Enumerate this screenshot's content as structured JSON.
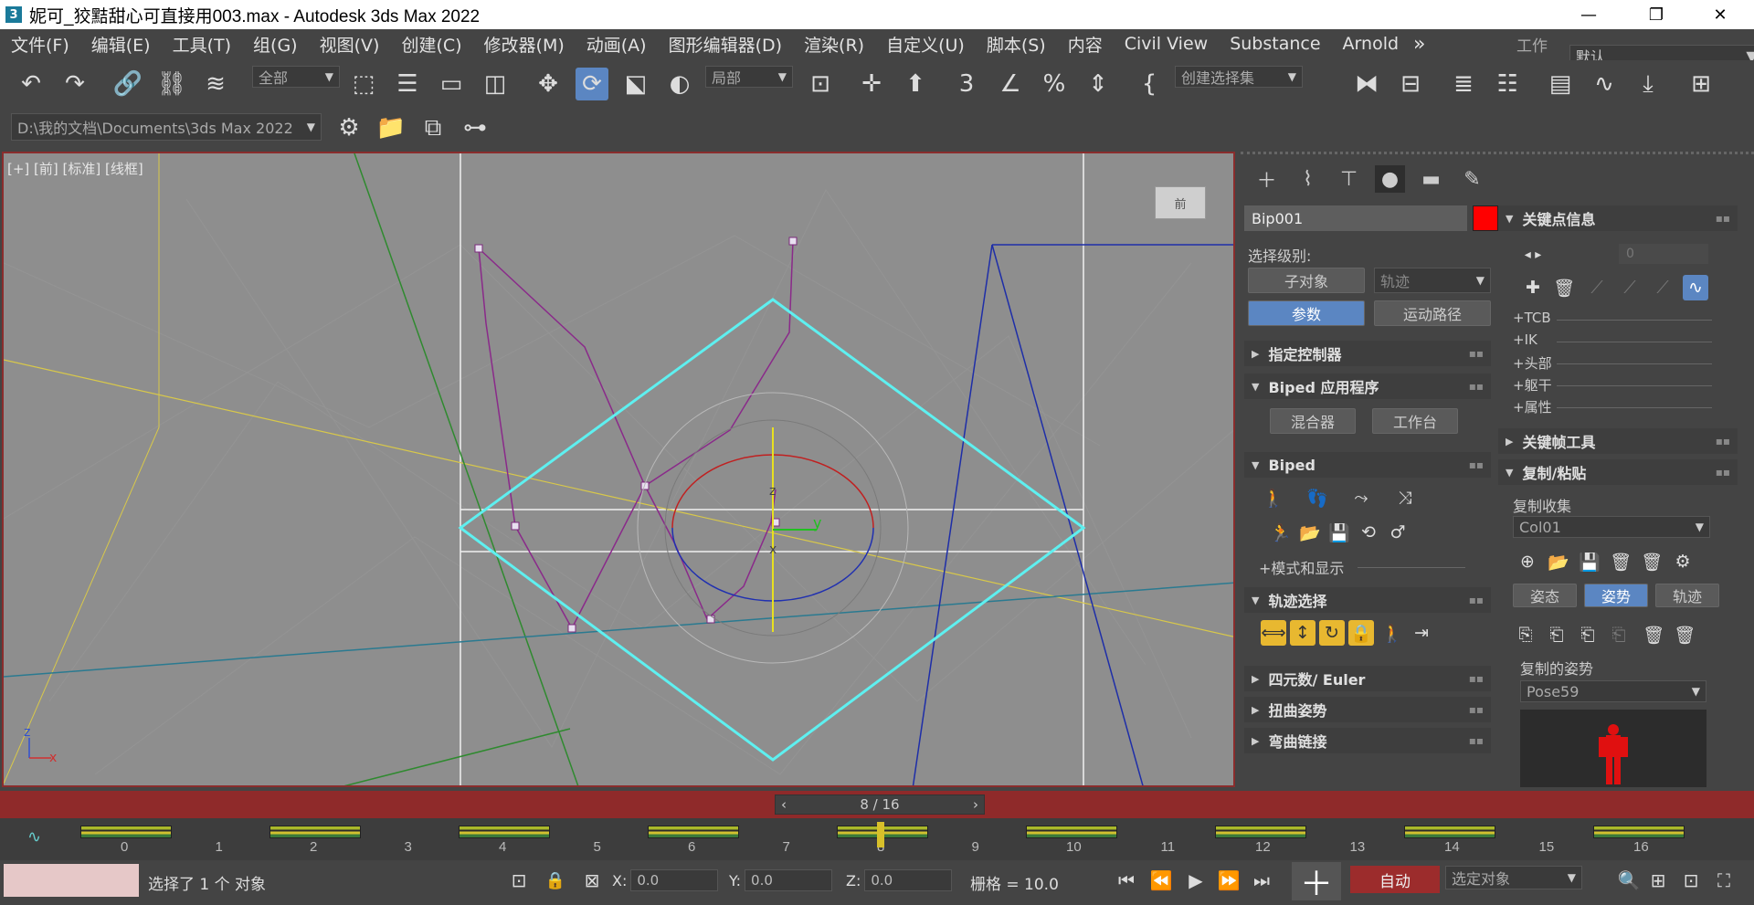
{
  "window": {
    "title": "妮可_狡黠甜心可直接用003.max - Autodesk 3ds Max 2022",
    "app_icon": "3",
    "minimize": "—",
    "restore": "❐",
    "close": "✕"
  },
  "menu": {
    "items": [
      "文件(F)",
      "编辑(E)",
      "工具(T)",
      "组(G)",
      "视图(V)",
      "创建(C)",
      "修改器(M)",
      "动画(A)",
      "图形编辑器(D)",
      "渲染(R)",
      "自定义(U)",
      "脚本(S)",
      "内容",
      "Civil View",
      "Substance",
      "Arnold"
    ],
    "more": "»",
    "workspace_label": "工作区:",
    "workspace_value": "默认"
  },
  "toolbar": {
    "filter_dropdown": "全部",
    "coord_dropdown": "局部",
    "selection_set_dropdown": "创建选择集",
    "path_dropdown": "D:\\我的文档\\Documents\\3ds Max 2022"
  },
  "viewport": {
    "label": "[+] [前] [标准] [线框]",
    "viewcube_label": "前",
    "axis_z": "z",
    "axis_x": "x",
    "gizmo_y": "y",
    "gizmo_z": "z",
    "gizmo_x": "x"
  },
  "command_panel": {
    "object_name": "Bip001",
    "object_color": "#ff0000",
    "select_level_label": "选择级别:",
    "sub_object_button": "子对象",
    "track_dropdown": "轨迹",
    "params_button": "参数",
    "motion_path_button": "运动路径",
    "rollouts": {
      "assign_controller": "指定控制器",
      "biped_apps": "Biped 应用程序",
      "biped": "Biped",
      "track_selection": "轨迹选择",
      "quaternion": "四元数/ Euler",
      "twist_poses": "扭曲姿势",
      "bend_links": "弯曲链接",
      "key_info": "关键点信息",
      "keyframe_tools": "关键帧工具",
      "copy_paste": "复制/粘贴"
    },
    "mixer_button": "混合器",
    "workbench_button": "工作台",
    "mode_display": "+模式和显示",
    "key_info_value": "0",
    "key_info_items": [
      "+TCB",
      "+IK",
      "+头部",
      "+躯干",
      "+属性"
    ],
    "copy_collection_label": "复制收集",
    "copy_collection_value": "Col01",
    "tabs": [
      "姿态",
      "姿势",
      "轨迹"
    ],
    "copied_poses_label": "复制的姿势",
    "pose_value": "Pose59"
  },
  "timeline": {
    "frame_display": "8 / 16",
    "ticks": [
      "0",
      "1",
      "2",
      "3",
      "4",
      "5",
      "6",
      "7",
      "8",
      "9",
      "10",
      "11",
      "12",
      "13",
      "14",
      "15",
      "16"
    ],
    "current_frame": 8,
    "total_frames": 16
  },
  "status": {
    "selection_text": "选择了 1 个 对象",
    "x_label": "X:",
    "x_value": "0.0",
    "y_label": "Y:",
    "y_value": "0.0",
    "z_label": "Z:",
    "z_value": "0.0",
    "grid_text": "栅格 = 10.0",
    "auto_key": "自动",
    "selected_objects": "选定对象"
  },
  "colors": {
    "accent_blue": "#5b86c2",
    "timeline_red": "#8f2a2a",
    "viewport_bg": "#8e8e8e",
    "panel_bg": "#444444"
  }
}
